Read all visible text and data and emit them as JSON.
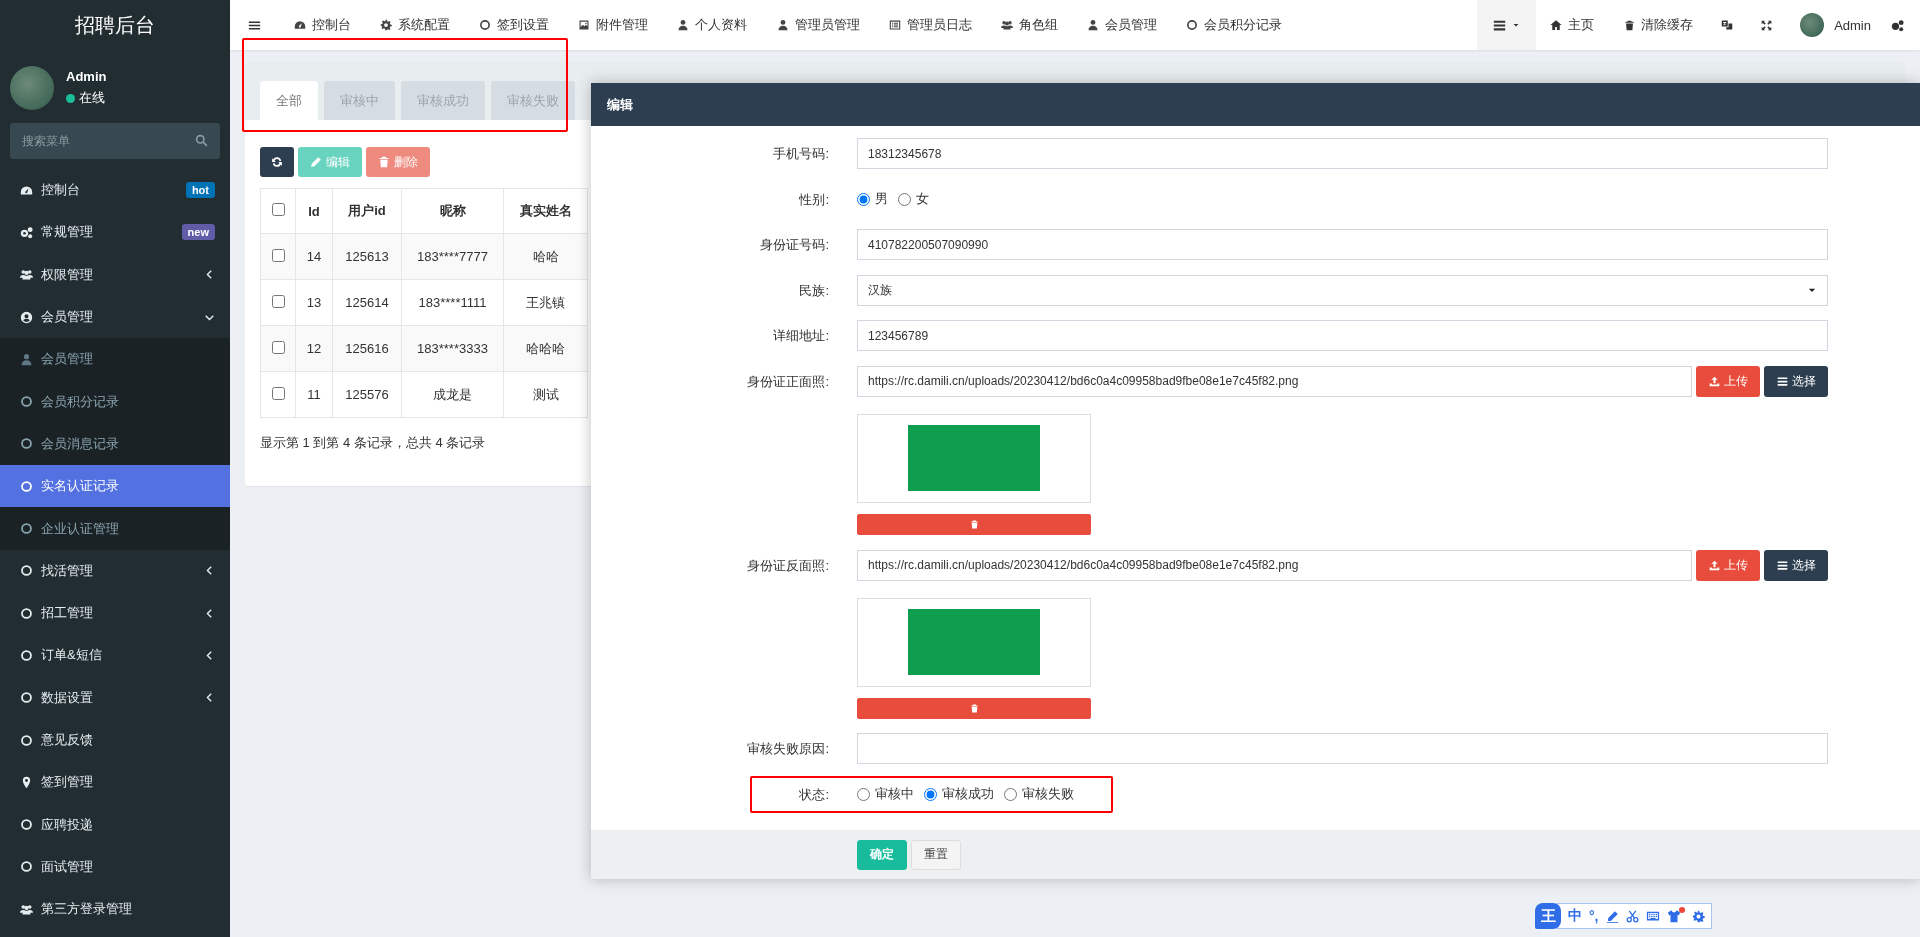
{
  "sidebar": {
    "title": "招聘后台",
    "user": {
      "name": "Admin",
      "status": "在线"
    },
    "search": {
      "placeholder": "搜索菜单"
    },
    "items": [
      {
        "label": "控制台",
        "selected": false,
        "badge": {
          "text": "hot",
          "color": "#0073b7"
        }
      },
      {
        "label": "常规管理",
        "selected": false,
        "badge": {
          "text": "new",
          "color": "#605ca8"
        }
      },
      {
        "label": "权限管理",
        "selected": false,
        "expanded": false
      },
      {
        "label": "会员管理",
        "selected": false,
        "expanded": true,
        "children": [
          {
            "label": "会员管理",
            "selected": false
          },
          {
            "label": "会员积分记录",
            "selected": false
          },
          {
            "label": "会员消息记录",
            "selected": false
          },
          {
            "label": "实名认证记录",
            "selected": true
          },
          {
            "label": "企业认证管理",
            "selected": false
          }
        ]
      },
      {
        "label": "找活管理",
        "selected": false,
        "expanded": false
      },
      {
        "label": "招工管理",
        "selected": false,
        "expanded": false
      },
      {
        "label": "订单&短信",
        "selected": false,
        "expanded": false
      },
      {
        "label": "数据设置",
        "selected": false,
        "expanded": false
      },
      {
        "label": "意见反馈",
        "selected": false
      },
      {
        "label": "签到管理",
        "selected": false
      },
      {
        "label": "应聘投递",
        "selected": false
      },
      {
        "label": "面试管理",
        "selected": false
      },
      {
        "label": "第三方登录管理",
        "selected": false
      }
    ]
  },
  "top_nav": {
    "items": [
      "控制台",
      "系统配置",
      "签到设置",
      "附件管理",
      "个人资料",
      "管理员管理",
      "管理员日志",
      "角色组",
      "会员管理",
      "会员积分记录"
    ],
    "home": "主页",
    "clear_cache": "清除缓存",
    "user": "Admin"
  },
  "tabs": {
    "highlighted": true,
    "items": [
      {
        "label": "全部",
        "selected": true
      },
      {
        "label": "审核中",
        "selected": false
      },
      {
        "label": "审核成功",
        "selected": false
      },
      {
        "label": "审核失败",
        "selected": false
      }
    ]
  },
  "toolbar": [
    {
      "kind": "refresh",
      "disabled": false
    },
    {
      "kind": "edit",
      "label": "编辑",
      "disabled": true
    },
    {
      "kind": "delete",
      "label": "删除",
      "disabled": true
    }
  ],
  "table": {
    "select_all": false,
    "columns": [
      "Id",
      "用户id",
      "昵称",
      "真实姓名"
    ],
    "rows": [
      {
        "checked": false,
        "cells": [
          "14",
          "125613",
          "183****7777",
          "哈哈"
        ]
      },
      {
        "checked": false,
        "cells": [
          "13",
          "125614",
          "183****1111",
          "王兆镇"
        ]
      },
      {
        "checked": false,
        "cells": [
          "12",
          "125616",
          "183****3333",
          "哈哈哈"
        ]
      },
      {
        "checked": false,
        "cells": [
          "11",
          "125576",
          "成龙是",
          "测试"
        ]
      }
    ],
    "summary": "显示第 1 到第 4 条记录，总共 4 条记录"
  },
  "modal": {
    "title": "编辑",
    "fields": [
      {
        "kind": "text",
        "label": "手机号码:",
        "value": "18312345678"
      },
      {
        "kind": "radio",
        "label": "性别:",
        "options": [
          {
            "label": "男",
            "selected": true
          },
          {
            "label": "女",
            "selected": false
          }
        ]
      },
      {
        "kind": "text",
        "label": "身份证号码:",
        "value": "410782200507090990"
      },
      {
        "kind": "select",
        "label": "民族:",
        "value": "汉族"
      },
      {
        "kind": "text",
        "label": "详细地址:",
        "value": "123456789"
      },
      {
        "kind": "upload",
        "label": "身份证正面照:",
        "value": "https://rc.damili.cn/uploads/20230412/bd6c0a4c09958bad9fbe08e1e7c45f82.png",
        "upload": "上传",
        "choose": "选择"
      },
      {
        "kind": "upload",
        "label": "身份证反面照:",
        "value": "https://rc.damili.cn/uploads/20230412/bd6c0a4c09958bad9fbe08e1e7c45f82.png",
        "upload": "上传",
        "choose": "选择"
      },
      {
        "kind": "text",
        "label": "审核失败原因:"
      },
      {
        "kind": "radio",
        "label": "状态:",
        "highlighted": true,
        "options": [
          {
            "label": "审核中",
            "selected": false
          },
          {
            "label": "审核成功",
            "selected": true
          },
          {
            "label": "审核失败",
            "selected": false
          }
        ]
      }
    ],
    "buttons": [
      {
        "kind": "primary",
        "label": "确定"
      },
      {
        "kind": "default",
        "label": "重置"
      }
    ]
  },
  "ime_toolbar": {
    "logo": "王",
    "mode": "中",
    "punctuation": "°,"
  }
}
